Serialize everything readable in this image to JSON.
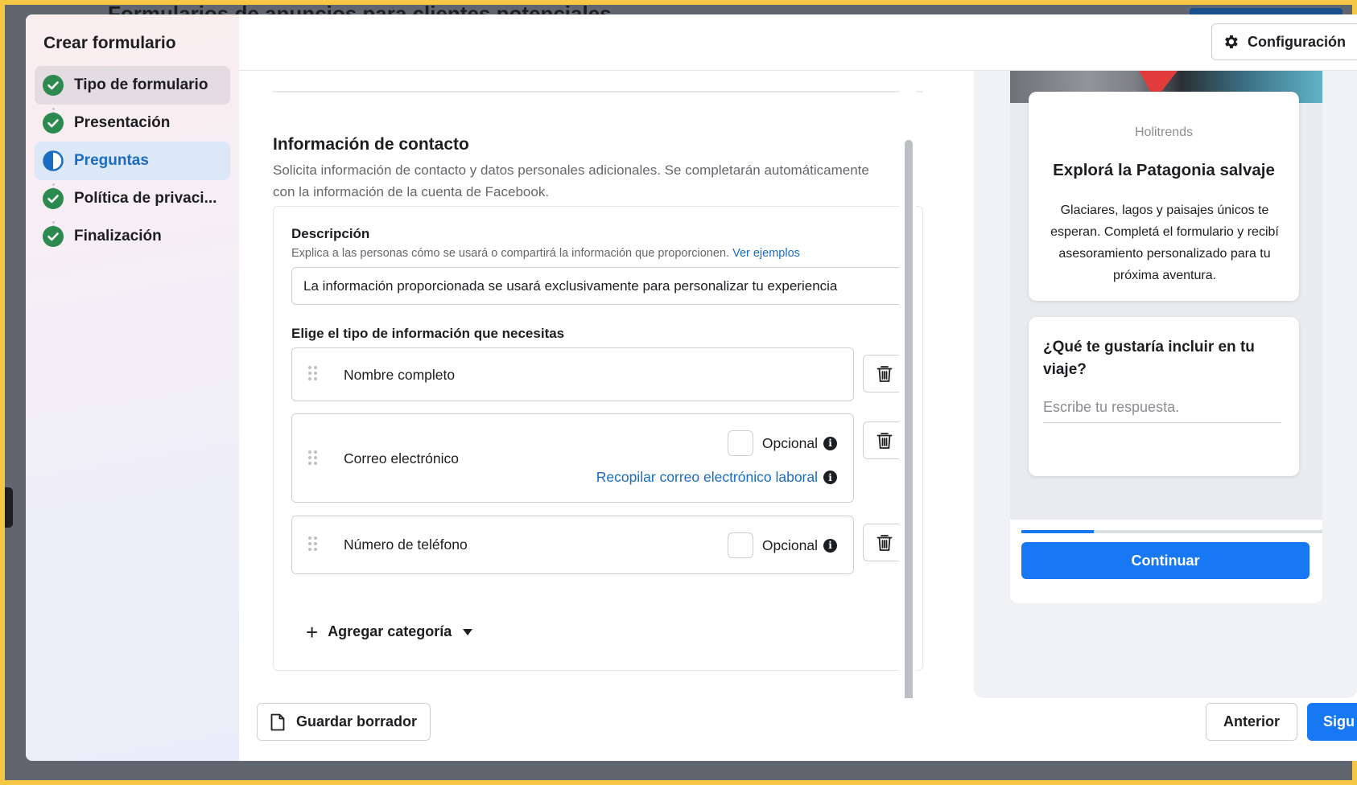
{
  "background": {
    "page_title": "Formularios de anuncios para clientes potenciales"
  },
  "sidebar": {
    "title": "Crear formulario",
    "steps": [
      {
        "label": "Tipo de formulario",
        "state": "done"
      },
      {
        "label": "Presentación",
        "state": "done"
      },
      {
        "label": "Preguntas",
        "state": "active"
      },
      {
        "label": "Política de privaci...",
        "state": "done"
      },
      {
        "label": "Finalización",
        "state": "done"
      }
    ]
  },
  "header": {
    "config_label": "Configuración"
  },
  "section": {
    "title": "Información de contacto",
    "description": "Solicita información de contacto y datos personales adicionales. Se completarán automáticamente con la información de la cuenta de Facebook."
  },
  "description_field": {
    "label": "Descripción",
    "help_text": "Explica a las personas cómo se usará o compartirá la información que proporcionen.",
    "help_link": "Ver ejemplos",
    "value": "La información proporcionada se usará exclusivamente para personalizar tu experiencia"
  },
  "info_types": {
    "label": "Elige el tipo de información que necesitas",
    "fields": [
      {
        "name": "Nombre completo"
      },
      {
        "name": "Correo electrónico",
        "optional_label": "Opcional",
        "work_email_link": "Recopilar correo electrónico laboral"
      },
      {
        "name": "Número de teléfono",
        "optional_label": "Opcional"
      }
    ],
    "add_category": "Agregar categoría"
  },
  "preview": {
    "brand": "Holitrends",
    "headline": "Explorá la Patagonia salvaje",
    "body": "Glaciares, lagos y paisajes únicos te esperan. Completá el formulario y recibí asesoramiento personalizado para tu próxima aventura.",
    "question": "¿Qué te gustaría incluir en tu viaje?",
    "answer_placeholder": "Escribe tu respuesta.",
    "progress": 0.24,
    "continue_label": "Continuar"
  },
  "footer": {
    "save_draft": "Guardar borrador",
    "previous": "Anterior",
    "next": "Sigu"
  },
  "colors": {
    "accent": "#1877f2",
    "link": "#1a6dc2",
    "success": "#2d8a4e",
    "frame": "#f6c744"
  }
}
